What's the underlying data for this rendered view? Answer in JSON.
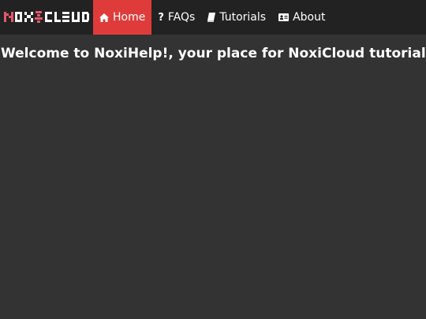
{
  "brand": {
    "logo_text": "NOXICLOUD",
    "logo_color_primary": "#ffffff",
    "logo_color_accent": "#e0586a"
  },
  "nav": {
    "items": [
      {
        "label": "Home",
        "icon": "home-icon",
        "active": true
      },
      {
        "label": "FAQs",
        "icon": "question-icon",
        "active": false
      },
      {
        "label": "Tutorials",
        "icon": "book-icon",
        "active": false
      },
      {
        "label": "About",
        "icon": "address-card-icon",
        "active": false
      }
    ],
    "active_color": "#e03b3b",
    "bar_color": "#222222"
  },
  "main": {
    "headline": "Welcome to NoxiHelp!, your place for NoxiCloud tutorials!"
  },
  "colors": {
    "background": "#333333",
    "text": "#ffffff"
  }
}
